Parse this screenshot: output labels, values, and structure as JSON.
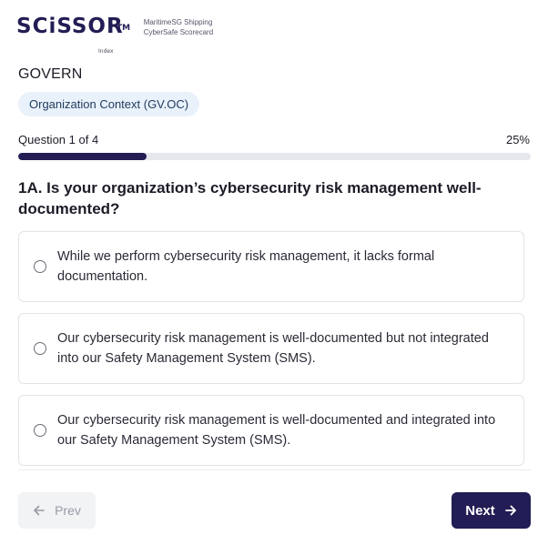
{
  "brand": {
    "wordmark": "SCiSSOR",
    "trademark": "TM",
    "sub": "Index",
    "tagline_line1": "MaritimeSG Shipping",
    "tagline_line2": "CyberSafe Scorecard"
  },
  "section": {
    "title": "GOVERN",
    "category": "Organization Context (GV.OC)"
  },
  "progress": {
    "label": "Question 1 of 4",
    "percent_text": "25%",
    "fraction": 0.25
  },
  "question": {
    "text": "1A. Is your organization’s cybersecurity risk management well-documented?",
    "options": [
      "While we perform cybersecurity risk management, it lacks formal documentation.",
      "Our cybersecurity risk management is well-documented but not integrated into our Safety Management System (SMS).",
      "Our cybersecurity risk management is well-documented and integrated into our Safety Management System (SMS)."
    ]
  },
  "nav": {
    "prev_label": "Prev",
    "next_label": "Next"
  },
  "colors": {
    "brand_navy": "#221d54",
    "pill_bg": "#e9f1fb",
    "track": "#e6e7ec"
  },
  "icons": {
    "prev": "arrow-left-icon",
    "next": "arrow-right-icon",
    "option": "radio-icon"
  }
}
